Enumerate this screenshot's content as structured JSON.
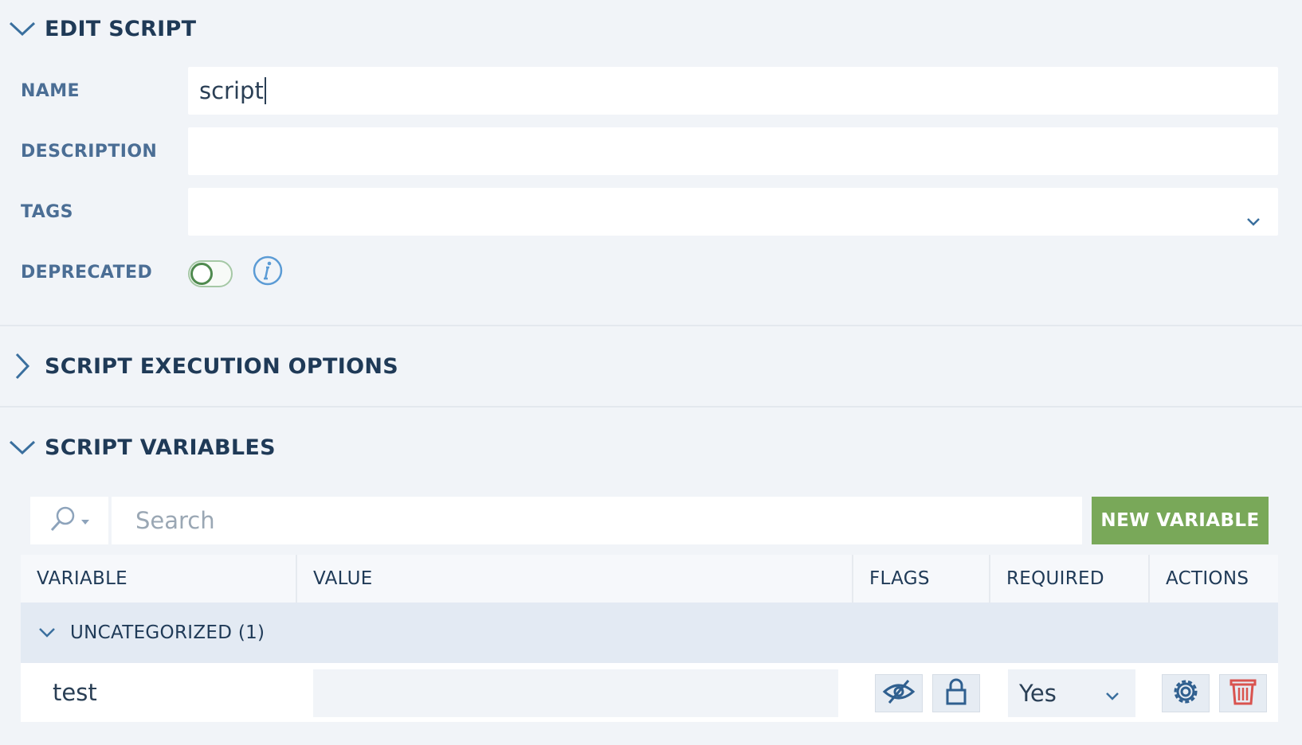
{
  "edit_section": {
    "title": "EDIT SCRIPT",
    "name_label": "NAME",
    "name_value": "script",
    "description_label": "DESCRIPTION",
    "description_value": "",
    "tags_label": "TAGS",
    "deprecated_label": "DEPRECATED",
    "deprecated_on": false
  },
  "execution_section": {
    "title": "SCRIPT EXECUTION OPTIONS",
    "expanded": false
  },
  "variables_section": {
    "title": "SCRIPT VARIABLES",
    "search_placeholder": "Search",
    "new_variable_label": "NEW VARIABLE",
    "columns": [
      "VARIABLE",
      "VALUE",
      "FLAGS",
      "REQUIRED",
      "ACTIONS"
    ],
    "group_label": "UNCATEGORIZED (1)",
    "rows": [
      {
        "name": "test",
        "value": "",
        "required": "Yes"
      }
    ]
  },
  "colors": {
    "accent_green": "#79a859",
    "label_blue": "#4b6e95",
    "delete_red": "#d9534f"
  }
}
